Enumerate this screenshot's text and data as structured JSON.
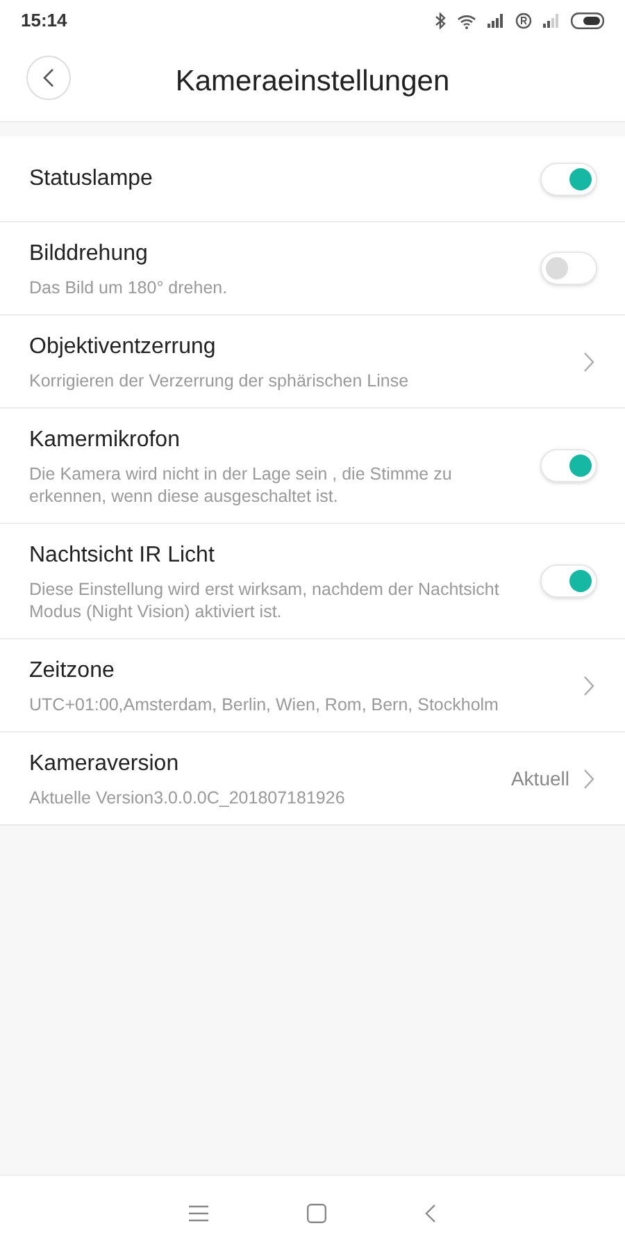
{
  "status_bar": {
    "time": "15:14"
  },
  "header": {
    "title": "Kameraeinstellungen"
  },
  "settings": [
    {
      "kind": "toggle",
      "title": "Statuslampe",
      "on": true
    },
    {
      "kind": "toggle",
      "title": "Bilddrehung",
      "subtitle": "Das Bild um 180° drehen.",
      "on": false
    },
    {
      "kind": "link",
      "title": "Objektiventzerrung",
      "subtitle": "Korrigieren der Verzerrung der sphärischen Linse"
    },
    {
      "kind": "toggle",
      "title": "Kamermikrofon",
      "subtitle": "Die Kamera wird nicht in der Lage sein , die Stimme zu erkennen, wenn diese ausgeschaltet ist.",
      "on": true
    },
    {
      "kind": "toggle",
      "title": "Nachtsicht IR Licht",
      "subtitle": "Diese Einstellung wird erst wirksam, nachdem der Nachtsicht Modus (Night Vision) aktiviert ist.",
      "on": true
    },
    {
      "kind": "link",
      "title": "Zeitzone",
      "subtitle": "UTC+01:00,Amsterdam, Berlin, Wien, Rom, Bern, Stockholm"
    },
    {
      "kind": "link",
      "title": "Kameraversion",
      "subtitle": "Aktuelle Version3.0.0.0C_201807181926",
      "value": "Aktuell"
    }
  ]
}
